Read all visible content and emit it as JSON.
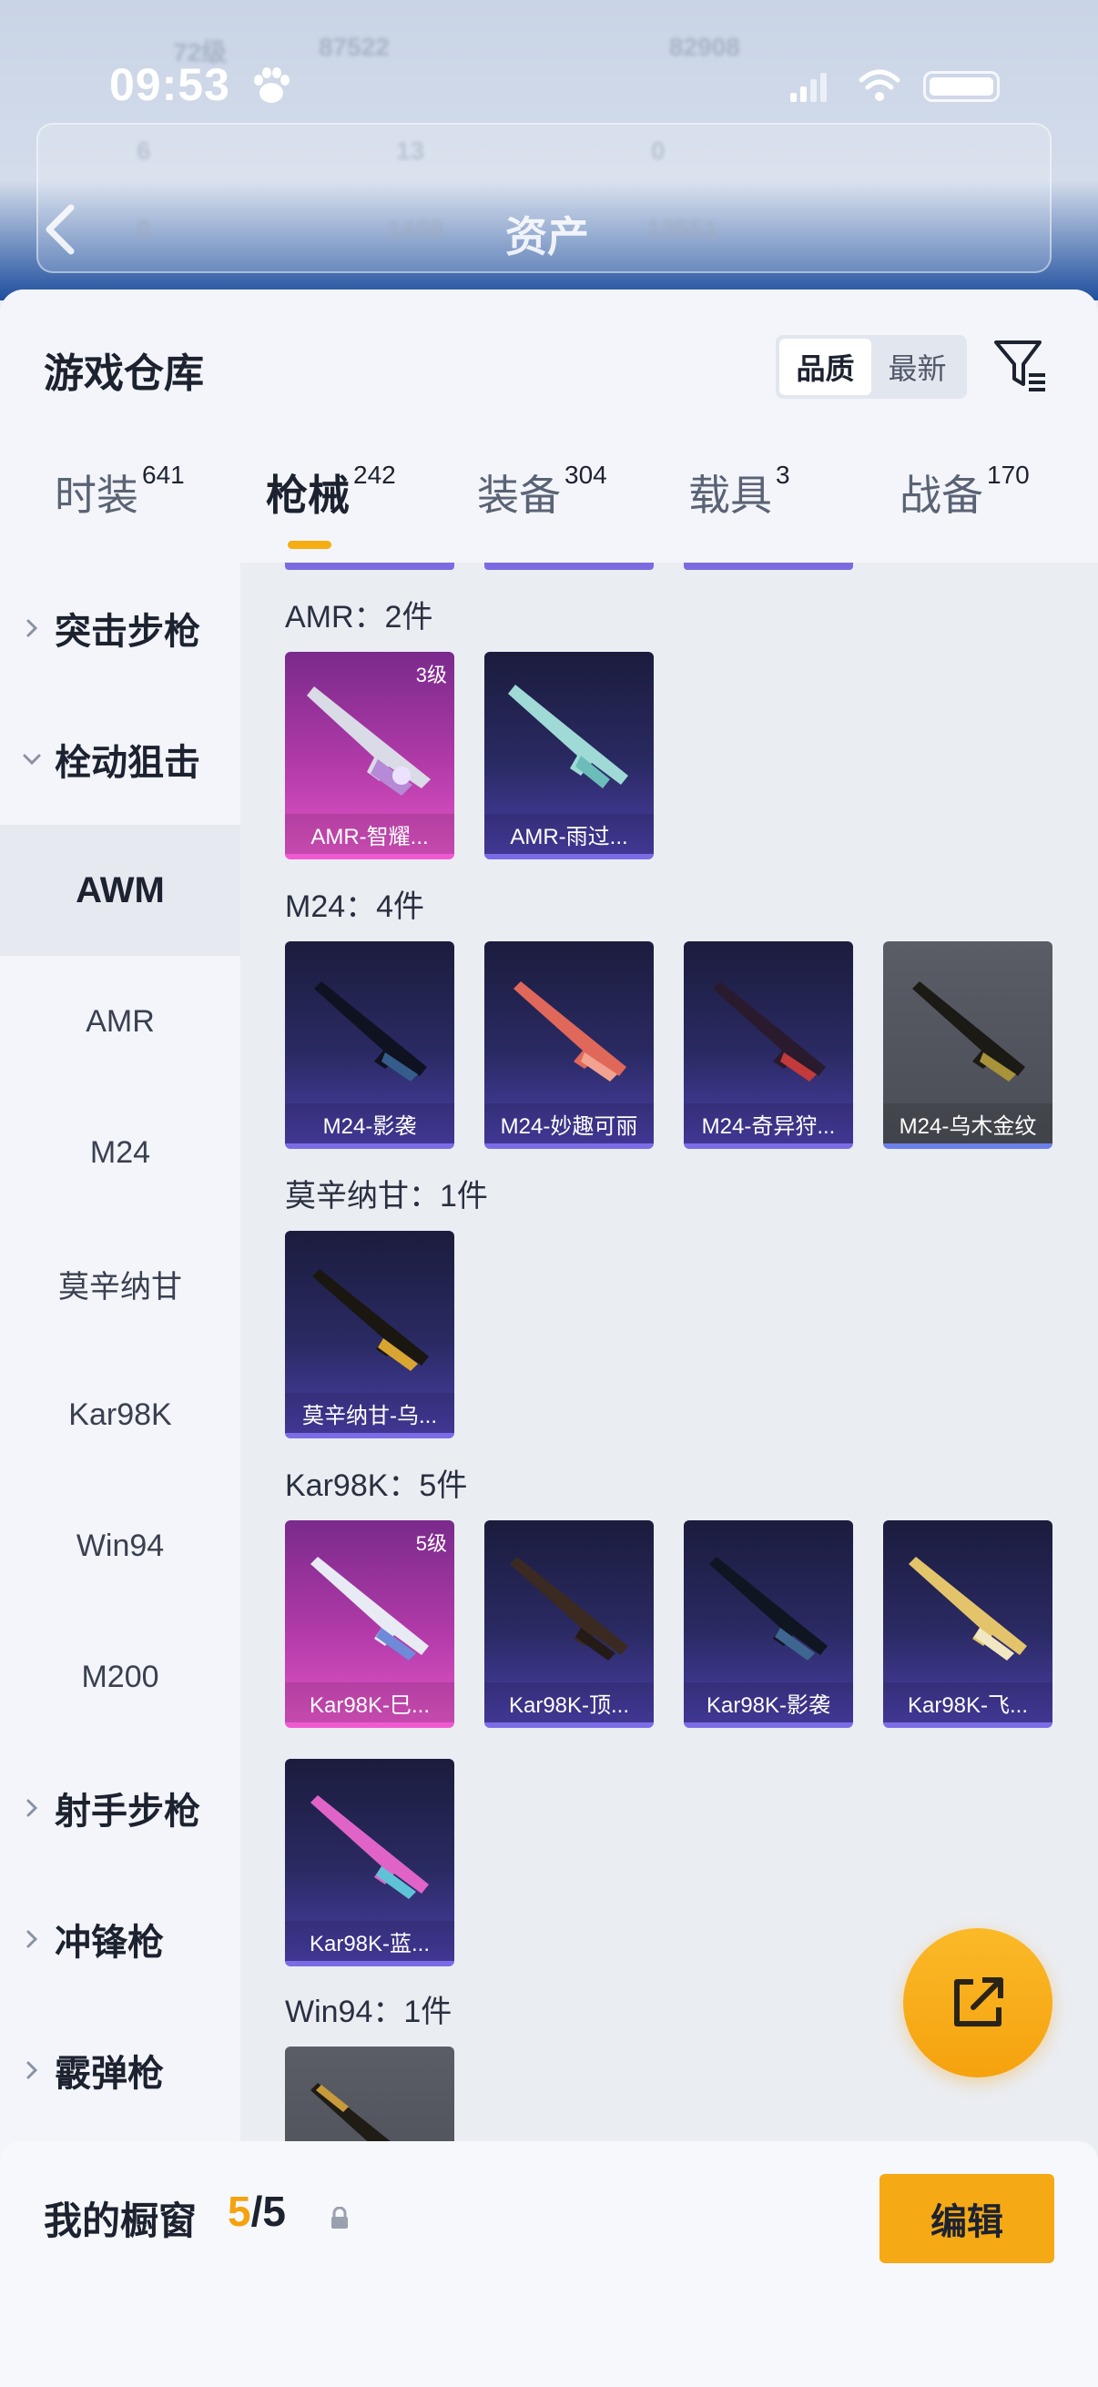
{
  "status_bar": {
    "time": "09:53"
  },
  "background": {
    "stats": [
      "72级",
      "87522",
      "82908",
      "6",
      "13",
      "0",
      "0",
      "1468",
      "13551"
    ],
    "title": "资产"
  },
  "sheet": {
    "title": "游戏仓库",
    "sort_options": [
      "品质",
      "最新"
    ],
    "active_sort": "品质"
  },
  "tabs": [
    {
      "label": "时装",
      "count": "641"
    },
    {
      "label": "枪械",
      "count": "242"
    },
    {
      "label": "装备",
      "count": "304"
    },
    {
      "label": "载具",
      "count": "3"
    },
    {
      "label": "战备",
      "count": "170"
    }
  ],
  "categories": [
    {
      "label": "突击步枪",
      "kind": "group",
      "expanded": false
    },
    {
      "label": "栓动狙击",
      "kind": "group",
      "expanded": true
    },
    {
      "label": "AWM",
      "kind": "sub",
      "selected": true
    },
    {
      "label": "AMR",
      "kind": "sub"
    },
    {
      "label": "M24",
      "kind": "sub"
    },
    {
      "label": "莫辛纳甘",
      "kind": "sub"
    },
    {
      "label": "Kar98K",
      "kind": "sub"
    },
    {
      "label": "Win94",
      "kind": "sub"
    },
    {
      "label": "M200",
      "kind": "sub"
    },
    {
      "label": "射手步枪",
      "kind": "group",
      "expanded": false
    },
    {
      "label": "冲锋枪",
      "kind": "group",
      "expanded": false
    },
    {
      "label": "霰弹枪",
      "kind": "group",
      "expanded": false
    }
  ],
  "sections": [
    {
      "title": "AMR：2件",
      "items": [
        {
          "name": "AMR-智耀...",
          "rarity": "legend",
          "level": "3级"
        },
        {
          "name": "AMR-雨过...",
          "rarity": "epic"
        }
      ]
    },
    {
      "title": "M24：4件",
      "items": [
        {
          "name": "M24-影袭",
          "rarity": "epic"
        },
        {
          "name": "M24-妙趣可丽",
          "rarity": "epic"
        },
        {
          "name": "M24-奇异狩...",
          "rarity": "epic"
        },
        {
          "name": "M24-乌木金纹",
          "rarity": "gray"
        }
      ]
    },
    {
      "title": "莫辛纳甘：1件",
      "items": [
        {
          "name": "莫辛纳甘-乌...",
          "rarity": "epic"
        }
      ]
    },
    {
      "title": "Kar98K：5件",
      "items": [
        {
          "name": "Kar98K-巳...",
          "rarity": "legend",
          "level": "5级"
        },
        {
          "name": "Kar98K-顶...",
          "rarity": "epic"
        },
        {
          "name": "Kar98K-影袭",
          "rarity": "epic"
        },
        {
          "name": "Kar98K-飞...",
          "rarity": "epic"
        },
        {
          "name": "Kar98K-蓝...",
          "rarity": "epic"
        }
      ]
    },
    {
      "title": "Win94：1件",
      "items": [
        {
          "name": "",
          "rarity": "gray"
        }
      ]
    }
  ],
  "showcase": {
    "label": "我的橱窗",
    "current": "5",
    "separator": "/",
    "max": "5",
    "edit_label": "编辑"
  },
  "colors": {
    "accent": "#f5a915",
    "epic": "#7b6ce6",
    "legend": "#e154c6"
  }
}
